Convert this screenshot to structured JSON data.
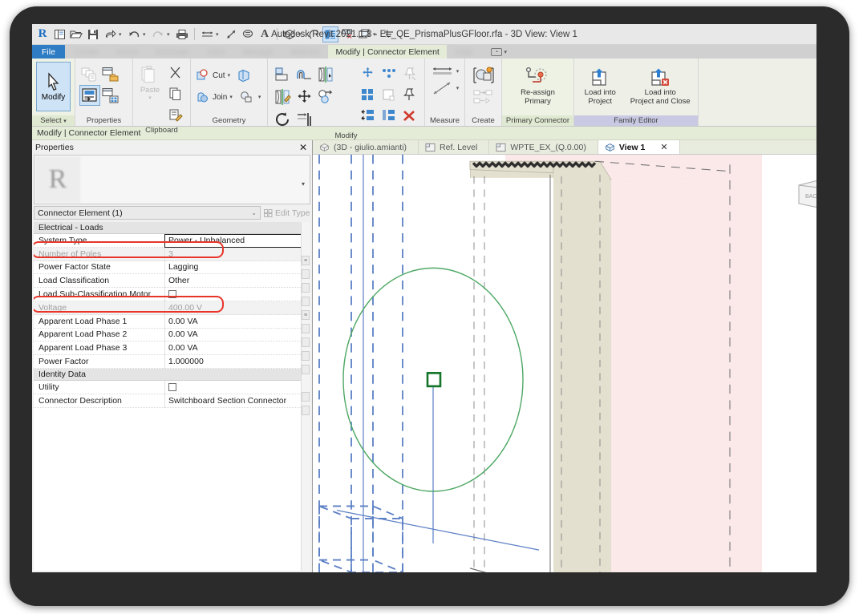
{
  "app": {
    "title": "Autodesk Revit 2021.1.8 - EL_QE_PrismaPlusGFloor.rfa - 3D View: View 1",
    "logo": "R"
  },
  "quick_access": {
    "items": [
      {
        "name": "revit-logo",
        "glyph": "R"
      },
      {
        "name": "new-icon",
        "glyph": ""
      },
      {
        "name": "open-icon",
        "glyph": ""
      },
      {
        "name": "save-icon",
        "glyph": ""
      },
      {
        "name": "save-as-icon",
        "glyph": ""
      },
      {
        "name": "undo-icon",
        "glyph": ""
      },
      {
        "name": "redo-icon",
        "glyph": ""
      },
      {
        "name": "print-icon",
        "glyph": ""
      },
      {
        "name": "measure-icon",
        "glyph": ""
      },
      {
        "name": "aligned-dimension-icon",
        "glyph": ""
      },
      {
        "name": "tag-icon",
        "glyph": ""
      },
      {
        "name": "text-icon",
        "glyph": "A"
      },
      {
        "name": "default-3d-view-icon",
        "glyph": ""
      },
      {
        "name": "section-icon",
        "glyph": ""
      },
      {
        "name": "thin-lines-icon",
        "glyph": ""
      },
      {
        "name": "close-hidden-windows-icon",
        "glyph": ""
      },
      {
        "name": "switch-windows-icon",
        "glyph": ""
      },
      {
        "name": "customize-qat-icon",
        "glyph": ""
      }
    ]
  },
  "ribbon": {
    "file_tab": "File",
    "blurred_tabs": [
      "Create",
      "Insert",
      "Annotate",
      "View",
      "Manage",
      "Add-Ins"
    ],
    "context_tab": "Modify | Connector Element",
    "blurred_tab_trailing": "Help",
    "display_toggle": "display-mode-toggle",
    "context_bar_label": "Modify | Connector Element",
    "panels": [
      {
        "name": "select",
        "title": "Select",
        "big_button": {
          "label": "Modify",
          "icon": "cursor-arrow-icon",
          "selected": true
        }
      },
      {
        "name": "properties",
        "title": "Properties",
        "buttons": [
          {
            "label": "",
            "icon": "type-properties-icon"
          },
          {
            "label": "",
            "icon": "family-category-icon"
          },
          {
            "label": "",
            "icon": "family-types-icon",
            "selected": true
          },
          {
            "label": "",
            "icon": "family-parameters-icon"
          }
        ]
      },
      {
        "name": "clipboard",
        "title": "Clipboard",
        "paste_label": "Paste",
        "buttons": [
          {
            "icon": "cut-icon"
          },
          {
            "icon": "copy-icon"
          },
          {
            "icon": "match-type-icon"
          }
        ]
      },
      {
        "name": "geometry",
        "title": "Geometry",
        "cut_label": "Cut",
        "join_label": "Join",
        "buttons": [
          {
            "icon": "cut-geometry-icon"
          },
          {
            "icon": "join-geometry-icon"
          },
          {
            "icon": "split-face-icon"
          },
          {
            "icon": "paint-icon"
          }
        ]
      },
      {
        "name": "modify",
        "title": "Modify",
        "buttons": [
          {
            "icon": "align-icon"
          },
          {
            "icon": "offset-icon"
          },
          {
            "icon": "mirror-pick-axis-icon"
          },
          {
            "icon": "mirror-draw-axis-icon"
          },
          {
            "icon": "move-icon"
          },
          {
            "icon": "copy-element-icon"
          },
          {
            "icon": "rotate-icon"
          },
          {
            "icon": "trim-extend-icon"
          },
          {
            "icon": "array-icon"
          },
          {
            "icon": "scale-icon"
          },
          {
            "icon": "pin-icon"
          },
          {
            "icon": "unpin-icon"
          },
          {
            "icon": "split-element-icon"
          },
          {
            "icon": "split-with-gap-icon"
          },
          {
            "icon": "delete-icon"
          }
        ]
      },
      {
        "name": "measure",
        "title": "Measure",
        "buttons": [
          {
            "icon": "measure-between-references-icon"
          },
          {
            "icon": "measure-along-element-icon"
          }
        ]
      },
      {
        "name": "create",
        "title": "Create",
        "buttons": [
          {
            "icon": "create-similar-icon"
          },
          {
            "icon": "create-group-icon"
          },
          {
            "icon": "create-part-icon"
          }
        ]
      },
      {
        "name": "primary-connector",
        "title": "Primary Connector",
        "big_button": {
          "label_line1": "Re-assign",
          "label_line2": "Primary",
          "icon": "re-assign-primary-icon"
        }
      },
      {
        "name": "family-editor",
        "title": "Family Editor",
        "big_buttons": [
          {
            "label_line1": "Load into",
            "label_line2": "Project",
            "icon": "load-into-project-icon"
          },
          {
            "label_line1": "Load into",
            "label_line2": "Project and Close",
            "icon": "load-into-project-close-icon"
          }
        ]
      }
    ]
  },
  "properties_palette": {
    "header": "Properties",
    "close": "✕",
    "thumbnail_glyph": "R",
    "type_dropdown_caret": "▾",
    "selector_value": "Connector Element (1)",
    "selector_caret": "⌄",
    "edit_type_label": "Edit Type",
    "groups": [
      {
        "name": "electrical-loads",
        "label": "Electrical - Loads",
        "rows": [
          {
            "key": "System Type",
            "value": "Power - Unbalanced",
            "state": "focus",
            "type": "text"
          },
          {
            "key": "Number of Poles",
            "value": "3",
            "state": "disabled",
            "type": "text",
            "highlight": true
          },
          {
            "key": "Power Factor State",
            "value": "Lagging",
            "state": "normal",
            "type": "text"
          },
          {
            "key": "Load Classification",
            "value": "Other",
            "state": "normal",
            "type": "text"
          },
          {
            "key": "Load Sub-Classification Motor",
            "value": "",
            "state": "normal",
            "type": "checkbox",
            "checked": false
          },
          {
            "key": "Voltage",
            "value": "400.00 V",
            "state": "disabled",
            "type": "text",
            "highlight": true
          },
          {
            "key": "Apparent Load Phase 1",
            "value": "0.00 VA",
            "state": "normal",
            "type": "text"
          },
          {
            "key": "Apparent Load Phase 2",
            "value": "0.00 VA",
            "state": "normal",
            "type": "text"
          },
          {
            "key": "Apparent Load Phase 3",
            "value": "0.00 VA",
            "state": "normal",
            "type": "text"
          },
          {
            "key": "Power Factor",
            "value": "1.000000",
            "state": "normal",
            "type": "text"
          }
        ]
      },
      {
        "name": "identity-data",
        "label": "Identity Data",
        "rows": [
          {
            "key": "Utility",
            "value": "",
            "state": "normal",
            "type": "checkbox",
            "checked": false
          },
          {
            "key": "Connector Description",
            "value": "Switchboard Section Connector",
            "state": "normal",
            "type": "text"
          }
        ]
      }
    ]
  },
  "view_tabs": [
    {
      "label": "(3D - giulio.amianti)",
      "icon": "3d-view-icon",
      "active": false
    },
    {
      "label": "Ref. Level",
      "icon": "plan-view-icon",
      "active": false
    },
    {
      "label": "WPTE_EX_(Q.0.00)",
      "icon": "plan-view-icon",
      "active": false
    },
    {
      "label": "View 1",
      "icon": "3d-view-icon",
      "active": true,
      "close": "✕"
    }
  ],
  "colors": {
    "accent_blue": "#2e7cc4",
    "context_green": "#e4ecd8",
    "family_editor_lilac": "#c9c9e4",
    "highlight_red": "#e8352a",
    "selection_green": "#2e8b3d",
    "reference_blue": "#5b7fc4",
    "wall_pink": "#fbe9ea",
    "slab_beige": "#e4e0cf",
    "frame_dark": "#2b2b2b"
  }
}
